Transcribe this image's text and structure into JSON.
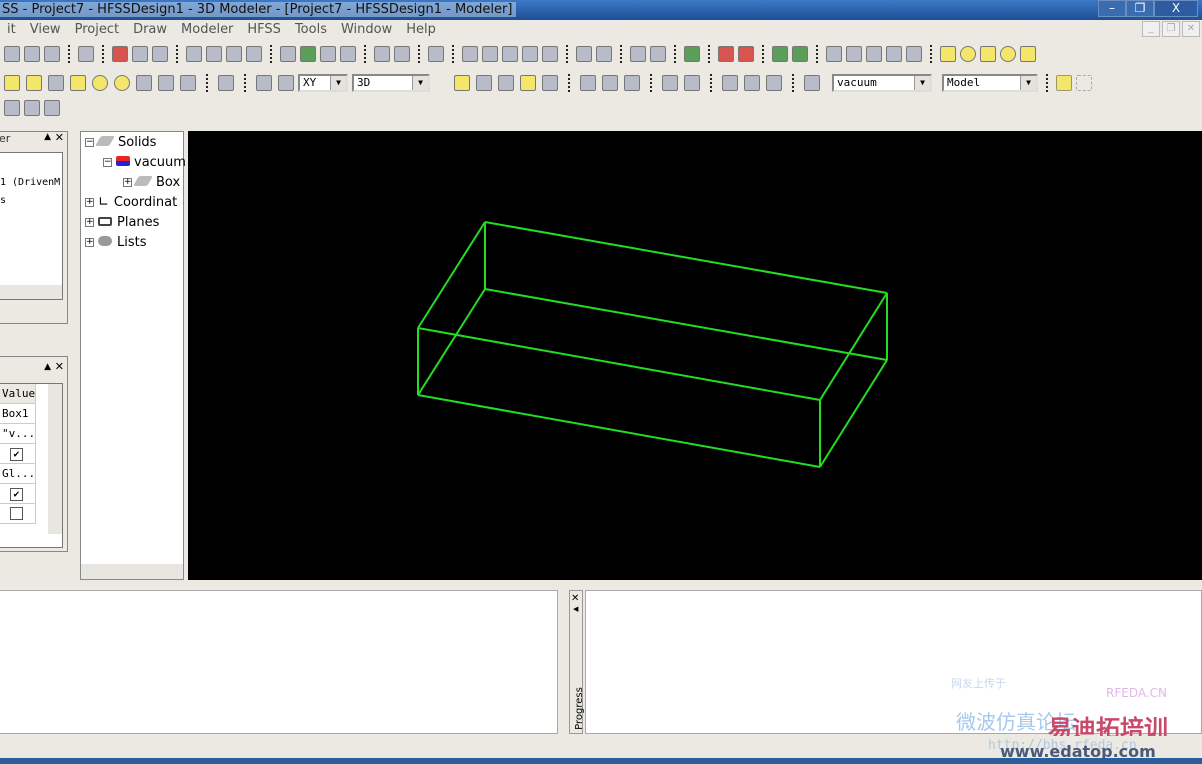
{
  "window": {
    "title": "SS - Project7 - HFSSDesign1 - 3D Modeler - [Project7 - HFSSDesign1 - Modeler]",
    "minimize": "–",
    "restore": "❐",
    "close": "X"
  },
  "menu": [
    "it",
    "View",
    "Project",
    "Draw",
    "Modeler",
    "HFSS",
    "Tools",
    "Window",
    "Help"
  ],
  "toolbar1": [
    "cut-icon",
    "copy-icon",
    "paste-icon",
    "|",
    "print-icon",
    "|",
    "delete-icon",
    "undo-icon",
    "redo-icon",
    "|",
    "select-icon",
    "import-icon",
    "export-icon",
    "quick-report-icon",
    "|",
    "script-icon",
    "validate-icon",
    "analyze-icon",
    "notes-icon",
    "|",
    "field-overlay-icon",
    "plot-icon",
    "|",
    "copy-image-icon",
    "|",
    "pan-icon",
    "rotate-icon",
    "rotate-axis-icon",
    "orbit-icon",
    "zoom-icon",
    "|",
    "zoom-in-icon",
    "zoom-out-icon",
    "|",
    "fit-all-icon",
    "fit-selected-icon",
    "|",
    "show-icon",
    "|",
    "hide-all-icon",
    "hide-selected-icon",
    "|",
    "show-all-icon",
    "show-selected-icon",
    "|",
    "line-icon",
    "spline-icon",
    "arc-icon",
    "center-arc-icon",
    "equation-curve-icon",
    "|",
    "rectangle-icon",
    "circle-icon",
    "polygon-icon",
    "ellipse-icon",
    "equation-surface-icon"
  ],
  "toolbar2a": [
    "box-icon",
    "cylinder-icon",
    "regular-polyhedron-icon",
    "cone-icon",
    "sphere-icon",
    "torus-icon",
    "helix-icon",
    "spiral-icon",
    "bondwire-icon",
    "|",
    "region-icon",
    "|",
    "point-icon",
    "plane-icon"
  ],
  "toolbar2b": [
    "unite-icon",
    "subtract-icon",
    "intersect-icon",
    "split-icon",
    "imprint-icon",
    "|",
    "move-icon",
    "rotate-object-icon",
    "mirror-icon",
    "|",
    "sweep-icon",
    "thicken-icon",
    "|",
    "duplicate-along-line-icon",
    "duplicate-around-axis-icon",
    "duplicate-mirror-icon",
    "|",
    "material-icon"
  ],
  "toolbar3": [
    "coordinate-system-icon",
    "relative-cs-icon",
    "face-cs-icon"
  ],
  "plane_select": "XY",
  "view_select": "3D",
  "material_select": "vacuum",
  "model_select": "Model",
  "project_manager": {
    "title": "er",
    "items": [
      "1 (DrivenM",
      "s"
    ]
  },
  "properties": {
    "header": "Value",
    "rows": [
      {
        "value": "Box1"
      },
      {
        "value": "\"v..."
      },
      {
        "check": true
      },
      {
        "value": "Gl..."
      },
      {
        "check": true
      },
      {
        "check": false
      }
    ]
  },
  "tree": {
    "solids": "Solids",
    "material": "vacuum",
    "box": "Box",
    "coords": "Coordinat",
    "planes": "Planes",
    "lists": "Lists"
  },
  "progress": {
    "label": "Progress"
  },
  "model_color": "#22dd22",
  "watermark": {
    "site": "RFEDA.CN",
    "brand": "易迪拓培训",
    "url": "www.edatop.com",
    "caption": "网友上传于",
    "cn": "微波仿真论坛",
    "url2": "http://bbs.rfeda.cn"
  }
}
